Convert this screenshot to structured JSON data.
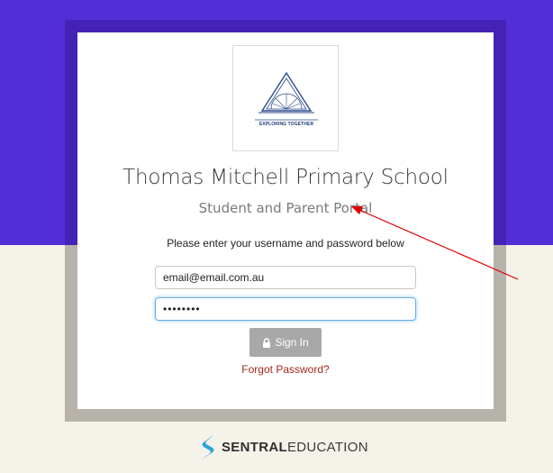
{
  "logo": {
    "icon": "school-emblem-icon",
    "motto": "EXPLORING TOGETHER"
  },
  "school": {
    "name": "Thomas Mitchell Primary School",
    "portal": "Student and Parent Portal"
  },
  "form": {
    "instruction": "Please enter your username and password below",
    "username_value": "email@email.com.au",
    "password_value": "••••••••",
    "signin_label": "Sign In",
    "signin_icon": "lock-icon",
    "forgot_label": "Forgot Password?"
  },
  "footer": {
    "brand_bold": "SENTRAL",
    "brand_rest": "EDUCATION",
    "brand_icon": "sentral-logo-icon"
  },
  "colors": {
    "brand_purple": "#522ed6",
    "frame_purple": "#4422b5",
    "background": "#f5f2ea",
    "link_red": "#a0281d",
    "button_grey": "#a8a8a8",
    "focus_blue": "#66afe9",
    "annotation_arrow": "#e00000"
  },
  "annotation": {
    "type": "red-arrow",
    "points_to": "portal-subtitle"
  }
}
